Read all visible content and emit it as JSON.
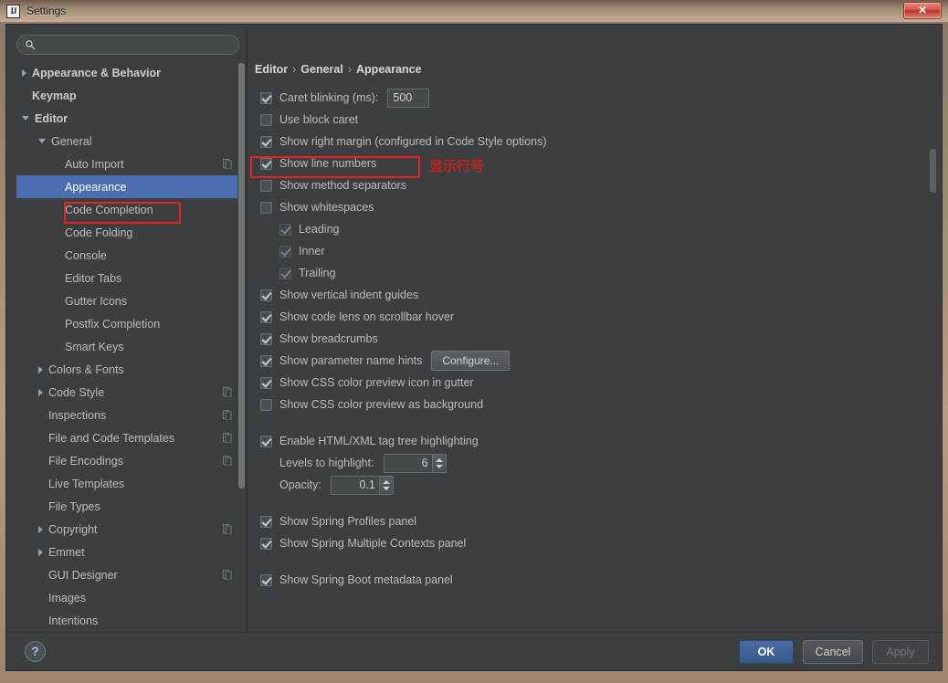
{
  "window": {
    "title": "Settings",
    "app_icon": "intellij-idea-icon",
    "close_label": "✕"
  },
  "search": {
    "value": "",
    "placeholder": "",
    "icon": "search-icon"
  },
  "sidebar": {
    "items": [
      {
        "label": "Appearance & Behavior",
        "level": 0,
        "twisty": "right",
        "bold": true,
        "selected": false,
        "config_icon": false
      },
      {
        "label": "Keymap",
        "level": 0,
        "twisty": "none",
        "bold": true,
        "selected": false,
        "config_icon": false
      },
      {
        "label": "Editor",
        "level": 0,
        "twisty": "down",
        "bold": true,
        "selected": false,
        "config_icon": false
      },
      {
        "label": "General",
        "level": 1,
        "twisty": "down",
        "bold": false,
        "selected": false,
        "config_icon": false
      },
      {
        "label": "Auto Import",
        "level": 2,
        "twisty": "none",
        "bold": false,
        "selected": false,
        "config_icon": true
      },
      {
        "label": "Appearance",
        "level": 2,
        "twisty": "none",
        "bold": false,
        "selected": true,
        "config_icon": false
      },
      {
        "label": "Code Completion",
        "level": 2,
        "twisty": "none",
        "bold": false,
        "selected": false,
        "config_icon": false
      },
      {
        "label": "Code Folding",
        "level": 2,
        "twisty": "none",
        "bold": false,
        "selected": false,
        "config_icon": false
      },
      {
        "label": "Console",
        "level": 2,
        "twisty": "none",
        "bold": false,
        "selected": false,
        "config_icon": false
      },
      {
        "label": "Editor Tabs",
        "level": 2,
        "twisty": "none",
        "bold": false,
        "selected": false,
        "config_icon": false
      },
      {
        "label": "Gutter Icons",
        "level": 2,
        "twisty": "none",
        "bold": false,
        "selected": false,
        "config_icon": false
      },
      {
        "label": "Postfix Completion",
        "level": 2,
        "twisty": "none",
        "bold": false,
        "selected": false,
        "config_icon": false
      },
      {
        "label": "Smart Keys",
        "level": 2,
        "twisty": "none",
        "bold": false,
        "selected": false,
        "config_icon": false
      },
      {
        "label": "Colors & Fonts",
        "level": 1,
        "twisty": "right",
        "bold": false,
        "selected": false,
        "config_icon": false
      },
      {
        "label": "Code Style",
        "level": 1,
        "twisty": "right",
        "bold": false,
        "selected": false,
        "config_icon": true
      },
      {
        "label": "Inspections",
        "level": 1,
        "twisty": "none",
        "bold": false,
        "selected": false,
        "config_icon": true
      },
      {
        "label": "File and Code Templates",
        "level": 1,
        "twisty": "none",
        "bold": false,
        "selected": false,
        "config_icon": true
      },
      {
        "label": "File Encodings",
        "level": 1,
        "twisty": "none",
        "bold": false,
        "selected": false,
        "config_icon": true
      },
      {
        "label": "Live Templates",
        "level": 1,
        "twisty": "none",
        "bold": false,
        "selected": false,
        "config_icon": false
      },
      {
        "label": "File Types",
        "level": 1,
        "twisty": "none",
        "bold": false,
        "selected": false,
        "config_icon": false
      },
      {
        "label": "Copyright",
        "level": 1,
        "twisty": "right",
        "bold": false,
        "selected": false,
        "config_icon": true
      },
      {
        "label": "Emmet",
        "level": 1,
        "twisty": "right",
        "bold": false,
        "selected": false,
        "config_icon": false
      },
      {
        "label": "GUI Designer",
        "level": 1,
        "twisty": "none",
        "bold": false,
        "selected": false,
        "config_icon": true
      },
      {
        "label": "Images",
        "level": 1,
        "twisty": "none",
        "bold": false,
        "selected": false,
        "config_icon": false
      },
      {
        "label": "Intentions",
        "level": 1,
        "twisty": "none",
        "bold": false,
        "selected": false,
        "config_icon": false
      }
    ]
  },
  "main": {
    "breadcrumb": {
      "part1": "Editor",
      "sep1": "›",
      "part2": "General",
      "sep2": "›",
      "part3": "Appearance"
    },
    "options": [
      {
        "label": "Caret blinking (ms):",
        "checked": true,
        "disabled": false,
        "indent": false,
        "control": "text",
        "value": "500"
      },
      {
        "label": "Use block caret",
        "checked": false,
        "disabled": false,
        "indent": false,
        "control": "none"
      },
      {
        "label": "Show right margin (configured in Code Style options)",
        "checked": true,
        "disabled": false,
        "indent": false,
        "control": "none"
      },
      {
        "label": "Show line numbers",
        "checked": true,
        "disabled": false,
        "indent": false,
        "control": "none"
      },
      {
        "label": "Show method separators",
        "checked": false,
        "disabled": false,
        "indent": false,
        "control": "none"
      },
      {
        "label": "Show whitespaces",
        "checked": false,
        "disabled": false,
        "indent": false,
        "control": "none"
      },
      {
        "label": "Leading",
        "checked": true,
        "disabled": true,
        "indent": true,
        "control": "none"
      },
      {
        "label": "Inner",
        "checked": true,
        "disabled": true,
        "indent": true,
        "control": "none"
      },
      {
        "label": "Trailing",
        "checked": true,
        "disabled": true,
        "indent": true,
        "control": "none"
      },
      {
        "label": "Show vertical indent guides",
        "checked": true,
        "disabled": false,
        "indent": false,
        "control": "none"
      },
      {
        "label": "Show code lens on scrollbar hover",
        "checked": true,
        "disabled": false,
        "indent": false,
        "control": "none"
      },
      {
        "label": "Show breadcrumbs",
        "checked": true,
        "disabled": false,
        "indent": false,
        "control": "none"
      },
      {
        "label": "Show parameter name hints",
        "checked": true,
        "disabled": false,
        "indent": false,
        "control": "button",
        "value": "Configure..."
      },
      {
        "label": "Show CSS color preview icon in gutter",
        "checked": true,
        "disabled": false,
        "indent": false,
        "control": "none"
      },
      {
        "label": "Show CSS color preview as background",
        "checked": false,
        "disabled": false,
        "indent": false,
        "control": "none"
      },
      {
        "label": "",
        "control": "spacer"
      },
      {
        "label": "Enable HTML/XML tag tree highlighting",
        "checked": true,
        "disabled": false,
        "indent": false,
        "control": "none"
      },
      {
        "label": "Levels to highlight:",
        "control": "spinner",
        "value": "6",
        "indent": true
      },
      {
        "label": "Opacity:",
        "control": "spinner",
        "value": "0.1",
        "indent": true
      },
      {
        "label": "",
        "control": "spacer"
      },
      {
        "label": "Show Spring Profiles panel",
        "checked": true,
        "disabled": false,
        "indent": false,
        "control": "none"
      },
      {
        "label": "Show Spring Multiple Contexts panel",
        "checked": true,
        "disabled": false,
        "indent": false,
        "control": "none"
      },
      {
        "label": "",
        "control": "spacer"
      },
      {
        "label": "Show Spring Boot metadata panel",
        "checked": true,
        "disabled": false,
        "indent": false,
        "control": "none"
      }
    ]
  },
  "footer": {
    "help_label": "?",
    "ok_label": "OK",
    "cancel_label": "Cancel",
    "apply_label": "Apply"
  },
  "annotations": {
    "note_text": "显示行号",
    "color": "#e8231c"
  }
}
